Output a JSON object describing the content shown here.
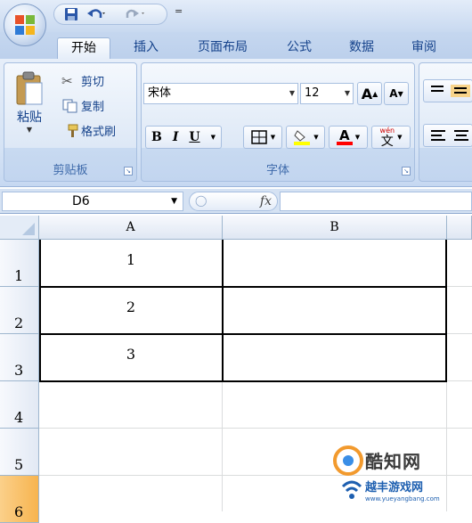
{
  "quick_access": {
    "more_glyph": "="
  },
  "tabs": [
    {
      "label": "开始",
      "active": true
    },
    {
      "label": "插入"
    },
    {
      "label": "页面布局"
    },
    {
      "label": "公式"
    },
    {
      "label": "数据"
    },
    {
      "label": "审阅"
    }
  ],
  "clipboard": {
    "paste_label": "粘贴",
    "cut_label": "剪切",
    "copy_label": "复制",
    "format_painter_label": "格式刷",
    "group_label": "剪贴板"
  },
  "font": {
    "font_name": "宋体",
    "font_size": "12",
    "grow_label": "A",
    "shrink_label": "A",
    "bold_label": "B",
    "italic_label": "I",
    "underline_label": "U",
    "font_color_label": "A",
    "phonetic_label": "wén",
    "phonetic_char": "文",
    "group_label": "字体"
  },
  "formula_bar": {
    "name_box": "D6",
    "fx_label": "fx",
    "formula": ""
  },
  "sheet": {
    "columns": [
      "A",
      "B"
    ],
    "rows": [
      "1",
      "2",
      "3",
      "4",
      "5",
      "6"
    ],
    "cells": {
      "A1": "1",
      "A2": "2",
      "A3": "3"
    }
  },
  "watermark": {
    "brand": "酷知网",
    "sub": "越丰游戏网",
    "url": "www.yueyangbang.com"
  },
  "colors": {
    "accent": "#15428b",
    "ribbon": "#d5e3f5",
    "selected_row": "#f7b44f"
  }
}
